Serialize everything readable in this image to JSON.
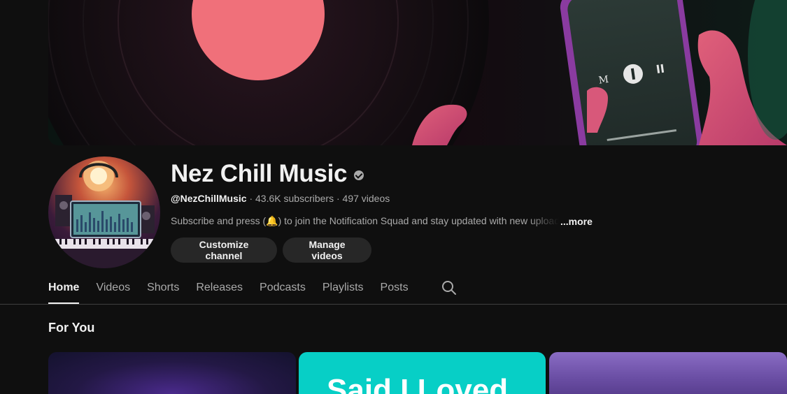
{
  "channel": {
    "name": "Nez Chill Music",
    "handle": "@NezChillMusic",
    "separator": "·",
    "subscribers": "43.6K subscribers",
    "videos": "497 videos",
    "description": "Subscribe and press (🔔) to join the Notification Squad and stay updated with new uploads",
    "more_label": "...more"
  },
  "buttons": {
    "customize": "Customize channel",
    "manage": "Manage videos"
  },
  "tabs": [
    {
      "label": "Home",
      "active": true
    },
    {
      "label": "Videos",
      "active": false
    },
    {
      "label": "Shorts",
      "active": false
    },
    {
      "label": "Releases",
      "active": false
    },
    {
      "label": "Podcasts",
      "active": false
    },
    {
      "label": "Playlists",
      "active": false
    },
    {
      "label": "Posts",
      "active": false
    }
  ],
  "search_icon": "search-icon",
  "section": {
    "title": "For You"
  },
  "videos": [
    {
      "thumbnail_text": ""
    },
    {
      "thumbnail_text": "Said I Loved"
    },
    {
      "thumbnail_text": ""
    }
  ],
  "colors": {
    "background": "#0f0f0f",
    "text": "#f1f1f1",
    "muted_text": "#aaaaaa",
    "button_bg": "#272727",
    "teal_thumbnail": "#07cfc6"
  }
}
